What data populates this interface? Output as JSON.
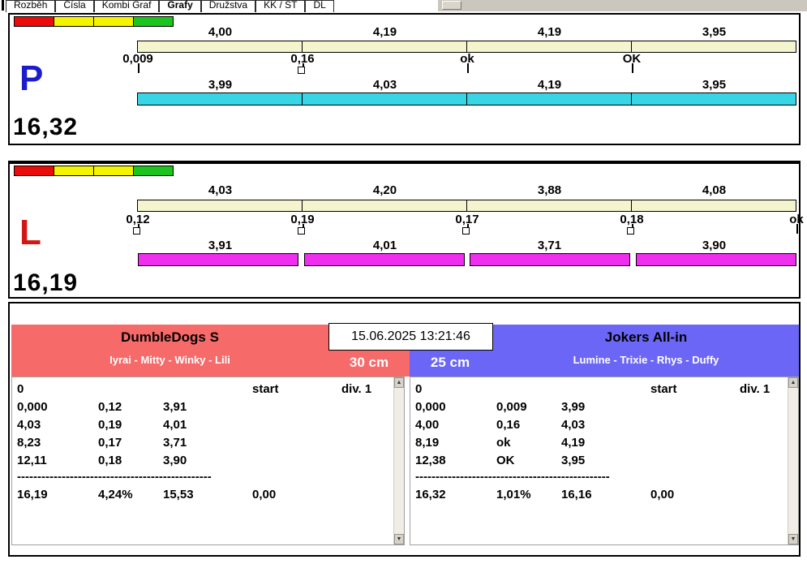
{
  "tabs": [
    "Rozběh",
    "Čísla",
    "Kombi Graf",
    "Grafy",
    "Družstva",
    "KK / ST",
    "DL"
  ],
  "active_tab": "Grafy",
  "clock": "15.06.2025 13:21:46",
  "legend_colors": [
    "#ea0b0b",
    "#f4f400",
    "#f4f400",
    "#1ec41e"
  ],
  "panel_p": {
    "letter": "P",
    "letter_color": "#1c1ccd",
    "total": "16,32",
    "split_values": [
      "4,00",
      "4,19",
      "4,19",
      "3,95"
    ],
    "sensor_labels": [
      "0,009",
      "0,16",
      "ok",
      "OK"
    ],
    "section_values": [
      "3,99",
      "4,03",
      "4,19",
      "3,95"
    ],
    "bar_color": "#38d5e5"
  },
  "panel_l": {
    "letter": "L",
    "letter_color": "#d21616",
    "total": "16,19",
    "split_values": [
      "4,03",
      "4,20",
      "3,88",
      "4,08"
    ],
    "sensor_labels": [
      "0,12",
      "0,19",
      "0,17",
      "0,18",
      "ok"
    ],
    "section_values": [
      "3,91",
      "4,01",
      "3,71",
      "3,90"
    ],
    "bar_color": "#ee2fee"
  },
  "team_left": {
    "name": "DumbleDogs S",
    "members": "Iyrai - Mitty - Winky - Lili",
    "size": "30 cm",
    "header_color": "#f76a6a",
    "table": {
      "zero": "0",
      "start_label": "start",
      "division_label": "div. 1",
      "rows": [
        [
          "0,000",
          "0,12",
          "3,91"
        ],
        [
          "4,03",
          "0,19",
          "4,01"
        ],
        [
          "8,23",
          "0,17",
          "3,71"
        ],
        [
          "12,11",
          "0,18",
          "3,90"
        ]
      ],
      "divider": "------------------------------------------------",
      "totals": [
        "16,19",
        "4,24%",
        "15,53",
        "0,00"
      ]
    }
  },
  "team_right": {
    "name": "Jokers All-in",
    "members": "Lumine - Trixie - Rhys - Duffy",
    "size": "25 cm",
    "header_color": "#6c66f7",
    "table": {
      "zero": "0",
      "start_label": "start",
      "division_label": "div. 1",
      "rows": [
        [
          "0,000",
          "0,009",
          "3,99"
        ],
        [
          "4,00",
          "0,16",
          "4,03"
        ],
        [
          "8,19",
          "ok",
          "4,19"
        ],
        [
          "12,38",
          "OK",
          "3,95"
        ]
      ],
      "divider": "------------------------------------------------",
      "totals": [
        "16,32",
        "1,01%",
        "16,16",
        "0,00"
      ]
    }
  }
}
